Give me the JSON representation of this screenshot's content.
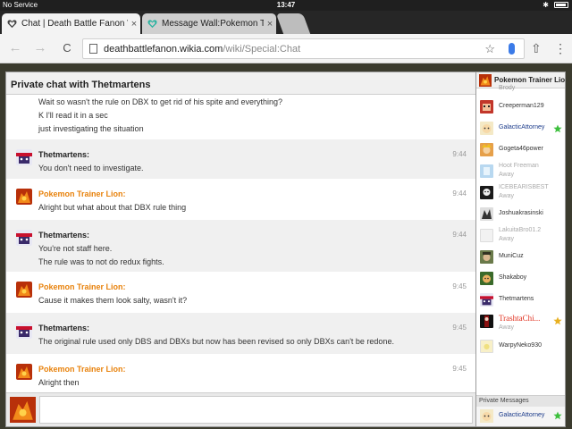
{
  "status": {
    "carrier": "No Service",
    "time": "13:47"
  },
  "tabs": [
    {
      "title": "Chat | Death Battle Fanon Wiki",
      "close": "×"
    },
    {
      "title": "Message Wall:Pokemon Trainer Lion",
      "close": "×"
    }
  ],
  "toolbar": {
    "back": "←",
    "forward": "→",
    "reload": "C",
    "url_domain": "deathbattlefanon.wikia.com",
    "url_path": "/wiki/Special:Chat",
    "star": "☆",
    "share": "⇧",
    "menu": "⋮"
  },
  "chat": {
    "header": "Private chat with Thetmartens",
    "continuation_lines": [
      "Wait so wasn't the rule on DBX to get rid of his spite and everything?",
      "K I'll read it in a sec",
      "just investigating the situation"
    ],
    "messages": [
      {
        "user": "Thetmartens:",
        "time": "9:44",
        "lines": [
          "You don't need to investigate."
        ]
      },
      {
        "user": "Pokemon Trainer Lion:",
        "time": "9:44",
        "lines": [
          "Alright but what about that DBX rule thing"
        ]
      },
      {
        "user": "Thetmartens:",
        "time": "9:44",
        "lines": [
          "You're not staff here.",
          "The rule was to not do redux fights."
        ]
      },
      {
        "user": "Pokemon Trainer Lion:",
        "time": "9:45",
        "lines": [
          "Cause it makes them look salty, wasn't it?"
        ]
      },
      {
        "user": "Thetmartens:",
        "time": "9:45",
        "lines": [
          "The original rule used only DBS and DBXs but now has been revised so only DBXs can't be redone."
        ]
      },
      {
        "user": "Pokemon Trainer Lion:",
        "time": "9:45",
        "lines": [
          "Alright then"
        ]
      }
    ]
  },
  "sidebar": {
    "header": "Pokemon Trainer Lion",
    "users": [
      {
        "name": "Brody",
        "away": ""
      },
      {
        "name": "Creeperman129",
        "away": ""
      },
      {
        "name": "GalacticAttorney",
        "away": ""
      },
      {
        "name": "Gogeta46power",
        "away": ""
      },
      {
        "name": "Hoot Freeman",
        "away": "Away"
      },
      {
        "name": "ICEBEARISBEST",
        "away": "Away"
      },
      {
        "name": "Joshuakrasinski",
        "away": ""
      },
      {
        "name": "LakuitaBro01.2",
        "away": "Away"
      },
      {
        "name": "MuniCuz",
        "away": ""
      },
      {
        "name": "Shakaboy",
        "away": ""
      },
      {
        "name": "Thetmartens",
        "away": ""
      },
      {
        "name": "TrashtaChi...",
        "away": "Away"
      },
      {
        "name": "WarpyNeko930",
        "away": ""
      }
    ],
    "private_messages_label": "Private Messages",
    "private_user": "GalacticAttorney"
  },
  "colors": {
    "trainer_name": "#e8820c",
    "thetmartens_name": "#222222",
    "galactic_name": "#1a3a8a",
    "trashta_name": "#e0301e",
    "chat_shade": "#f0f0f0",
    "page_bg": "#3b3b2e"
  }
}
